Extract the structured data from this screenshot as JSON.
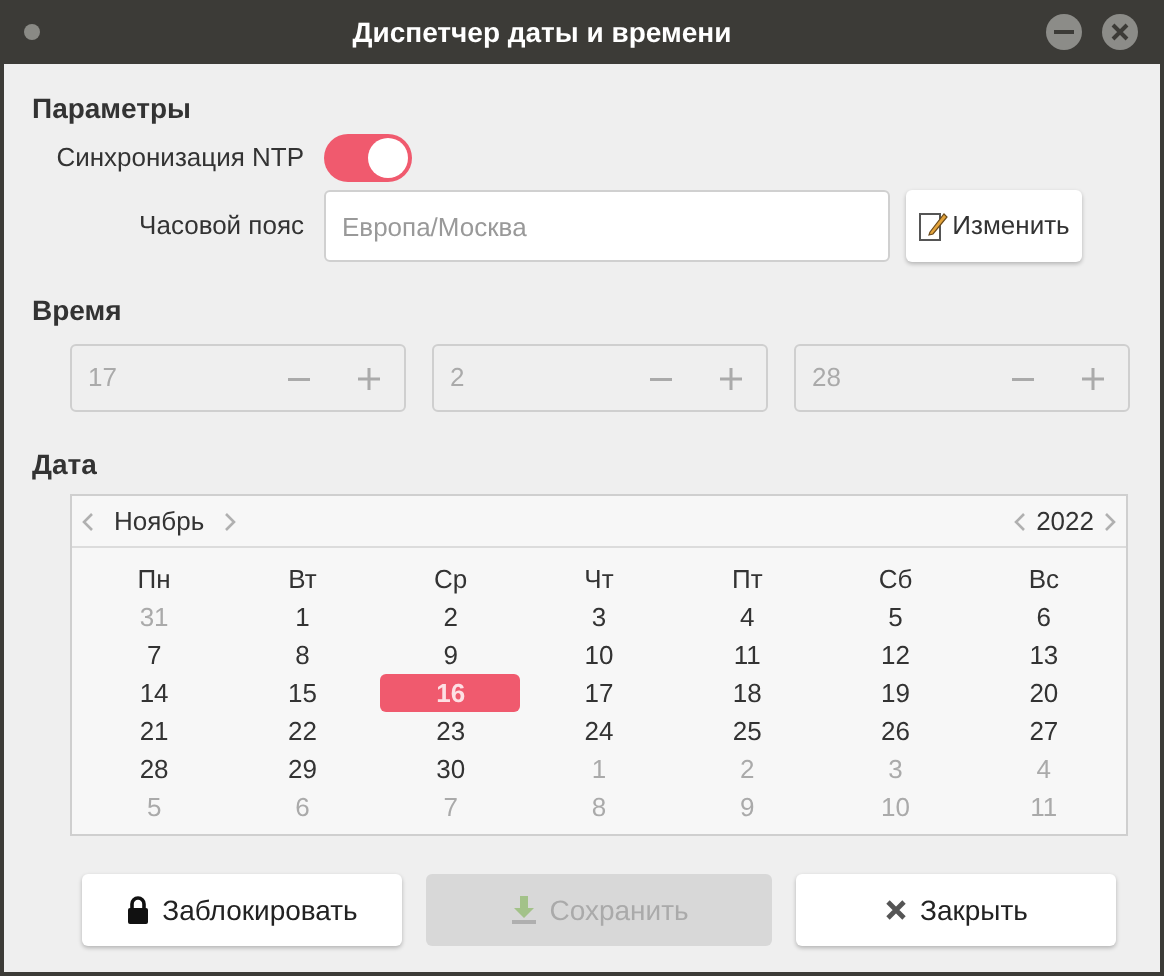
{
  "window": {
    "title": "Диспетчер даты и времени"
  },
  "params": {
    "heading": "Параметры",
    "ntp": {
      "label": "Синхронизация NTP",
      "on": true
    },
    "timezone": {
      "label": "Часовой пояс",
      "placeholder": "Европа/Москва",
      "button": "Изменить"
    }
  },
  "time": {
    "heading": "Время",
    "fields": [
      {
        "value": "17",
        "disabled": true
      },
      {
        "value": "2",
        "disabled": true
      },
      {
        "value": "28",
        "disabled": true
      }
    ]
  },
  "date": {
    "heading": "Дата",
    "month": "Ноябрь",
    "year": "2022",
    "weekdays": [
      "Пн",
      "Вт",
      "Ср",
      "Чт",
      "Пт",
      "Сб",
      "Вс"
    ],
    "weeks": [
      [
        {
          "text": "31",
          "other_month": true,
          "selected": false
        },
        {
          "text": "1",
          "other_month": false,
          "selected": false
        },
        {
          "text": "2",
          "other_month": false,
          "selected": false
        },
        {
          "text": "3",
          "other_month": false,
          "selected": false
        },
        {
          "text": "4",
          "other_month": false,
          "selected": false
        },
        {
          "text": "5",
          "other_month": false,
          "selected": false
        },
        {
          "text": "6",
          "other_month": false,
          "selected": false
        }
      ],
      [
        {
          "text": "7",
          "other_month": false,
          "selected": false
        },
        {
          "text": "8",
          "other_month": false,
          "selected": false
        },
        {
          "text": "9",
          "other_month": false,
          "selected": false
        },
        {
          "text": "10",
          "other_month": false,
          "selected": false
        },
        {
          "text": "11",
          "other_month": false,
          "selected": false
        },
        {
          "text": "12",
          "other_month": false,
          "selected": false
        },
        {
          "text": "13",
          "other_month": false,
          "selected": false
        }
      ],
      [
        {
          "text": "14",
          "other_month": false,
          "selected": false
        },
        {
          "text": "15",
          "other_month": false,
          "selected": false
        },
        {
          "text": "16",
          "other_month": false,
          "selected": true
        },
        {
          "text": "17",
          "other_month": false,
          "selected": false
        },
        {
          "text": "18",
          "other_month": false,
          "selected": false
        },
        {
          "text": "19",
          "other_month": false,
          "selected": false
        },
        {
          "text": "20",
          "other_month": false,
          "selected": false
        }
      ],
      [
        {
          "text": "21",
          "other_month": false,
          "selected": false
        },
        {
          "text": "22",
          "other_month": false,
          "selected": false
        },
        {
          "text": "23",
          "other_month": false,
          "selected": false
        },
        {
          "text": "24",
          "other_month": false,
          "selected": false
        },
        {
          "text": "25",
          "other_month": false,
          "selected": false
        },
        {
          "text": "26",
          "other_month": false,
          "selected": false
        },
        {
          "text": "27",
          "other_month": false,
          "selected": false
        }
      ],
      [
        {
          "text": "28",
          "other_month": false,
          "selected": false
        },
        {
          "text": "29",
          "other_month": false,
          "selected": false
        },
        {
          "text": "30",
          "other_month": false,
          "selected": false
        },
        {
          "text": "1",
          "other_month": true,
          "selected": false
        },
        {
          "text": "2",
          "other_month": true,
          "selected": false
        },
        {
          "text": "3",
          "other_month": true,
          "selected": false
        },
        {
          "text": "4",
          "other_month": true,
          "selected": false
        }
      ],
      [
        {
          "text": "5",
          "other_month": true,
          "selected": false
        },
        {
          "text": "6",
          "other_month": true,
          "selected": false
        },
        {
          "text": "7",
          "other_month": true,
          "selected": false
        },
        {
          "text": "8",
          "other_month": true,
          "selected": false
        },
        {
          "text": "9",
          "other_month": true,
          "selected": false
        },
        {
          "text": "10",
          "other_month": true,
          "selected": false
        },
        {
          "text": "11",
          "other_month": true,
          "selected": false
        }
      ]
    ]
  },
  "buttons": [
    {
      "kind": "lock",
      "label": "Заблокировать",
      "disabled": false
    },
    {
      "kind": "save",
      "label": "Сохранить",
      "disabled": true
    },
    {
      "kind": "close",
      "label": "Закрыть",
      "disabled": false
    }
  ]
}
